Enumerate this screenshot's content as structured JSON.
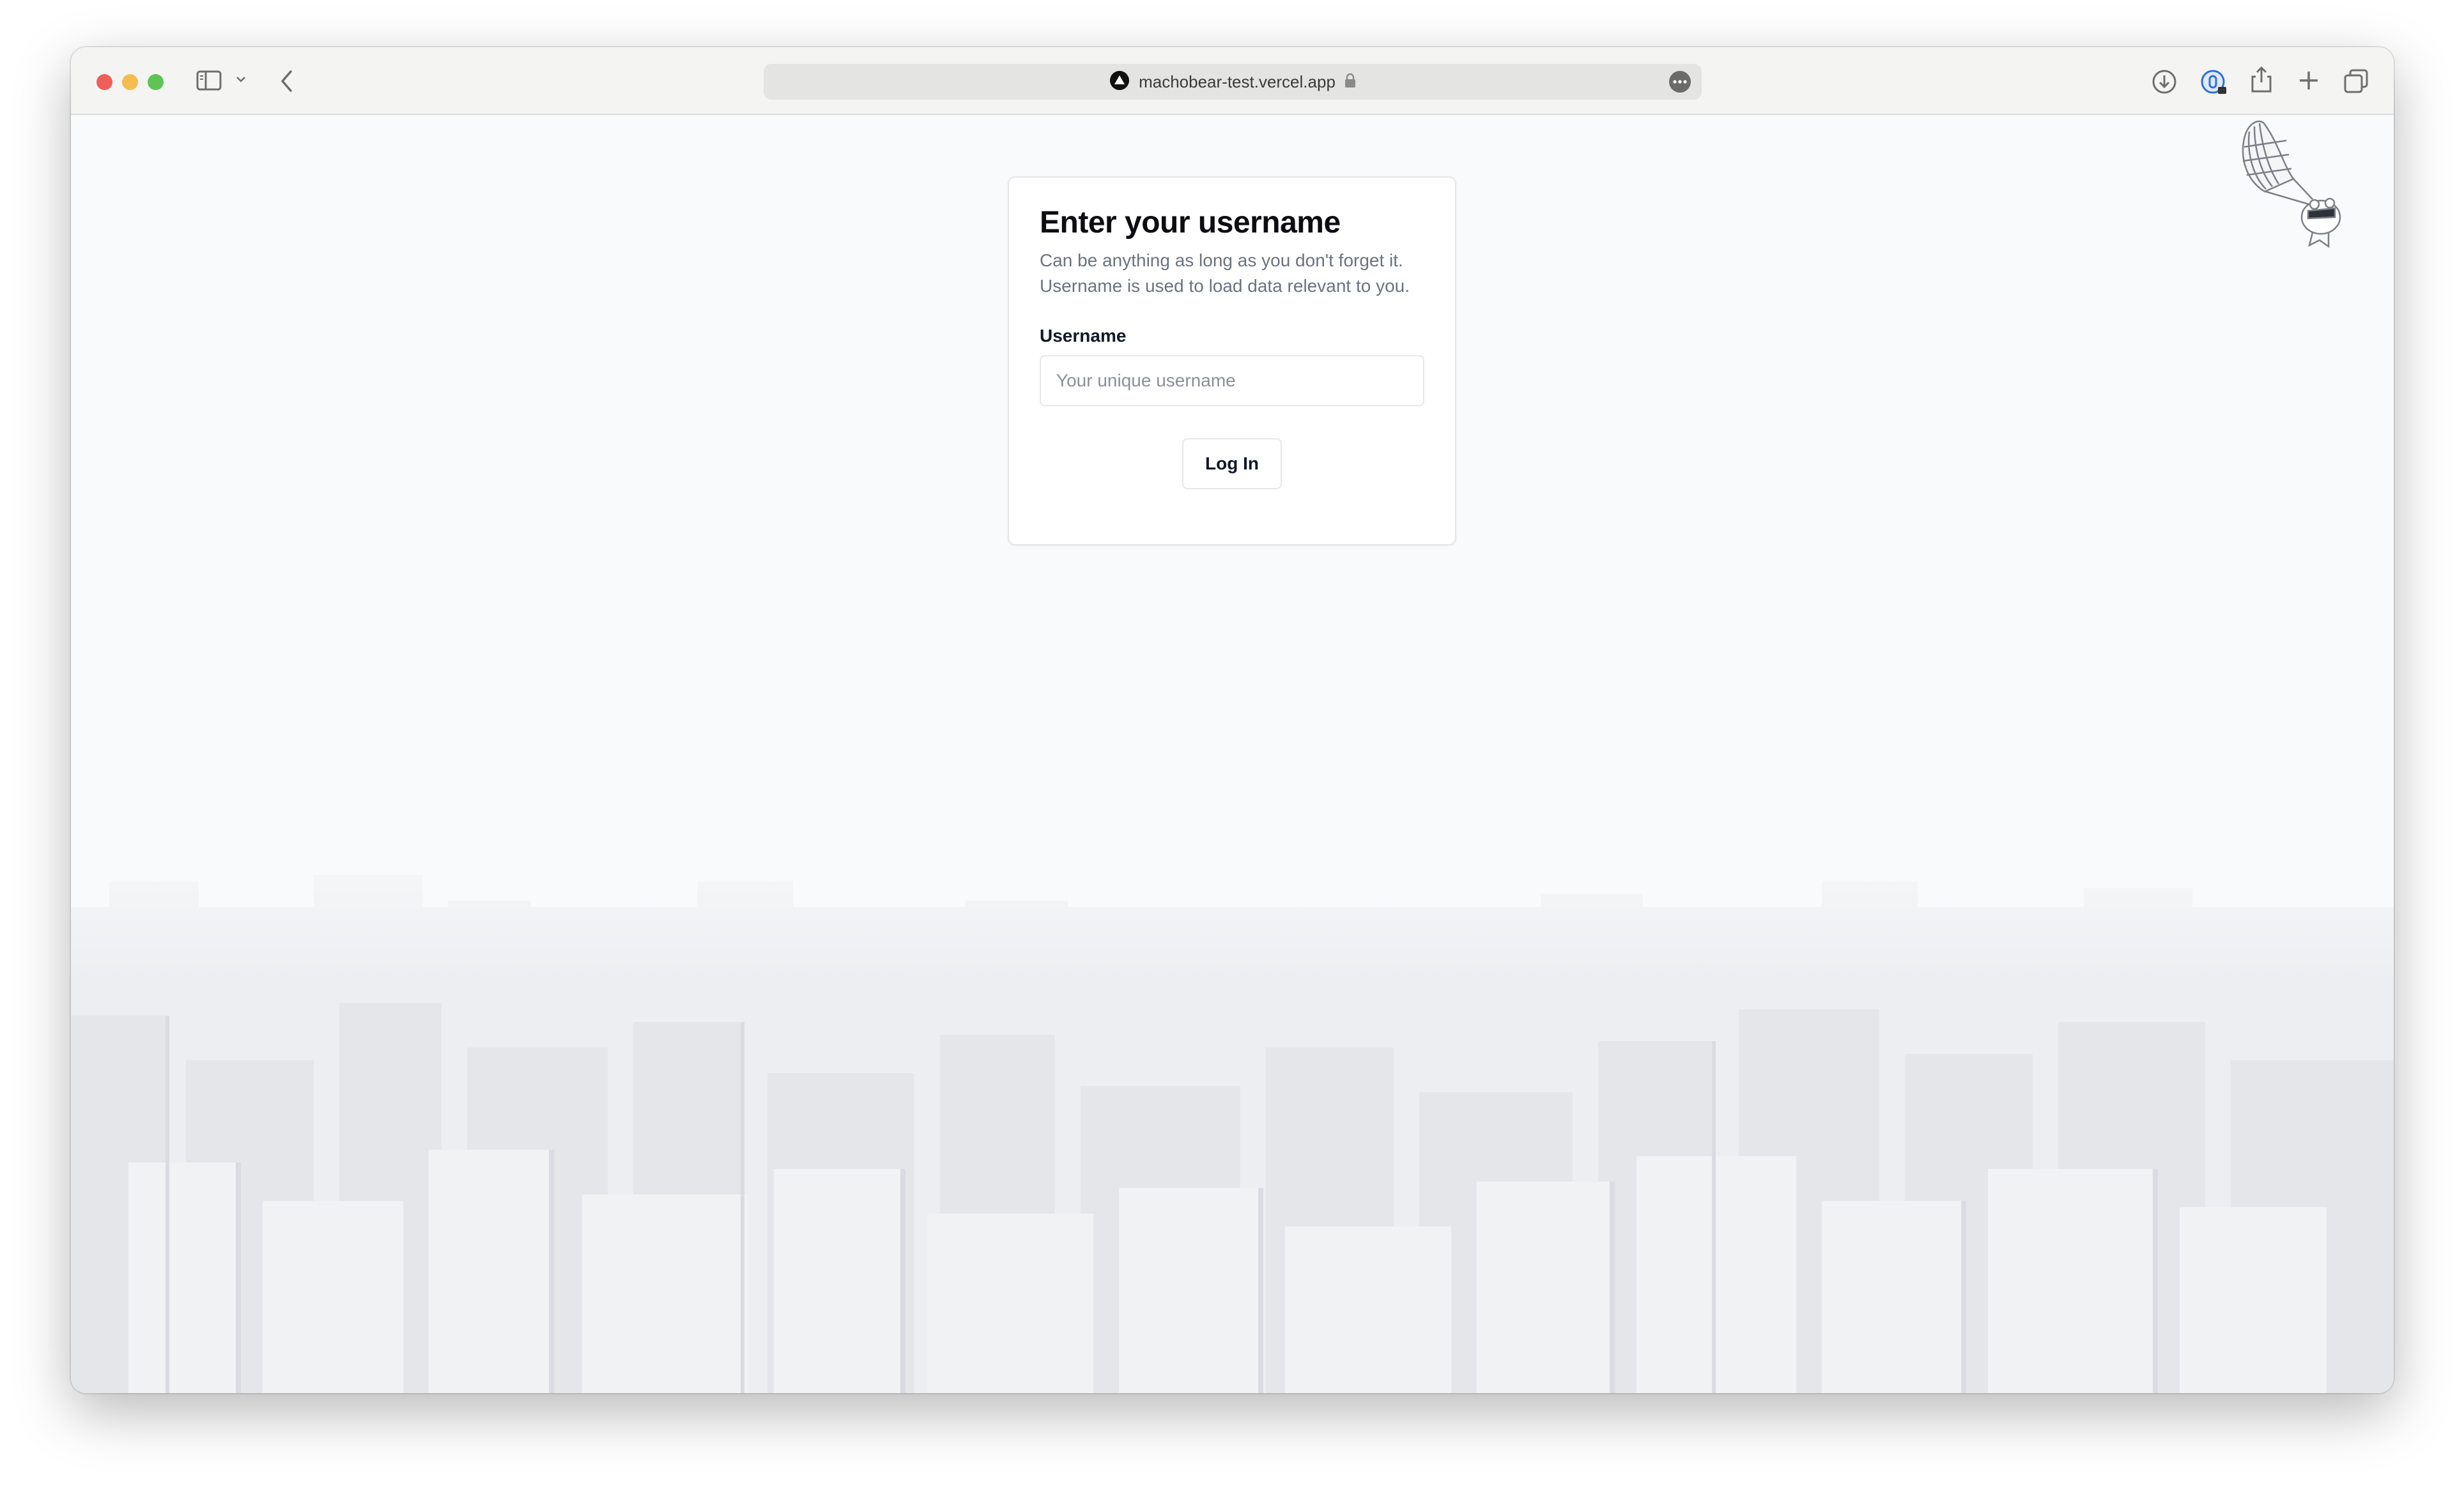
{
  "browser": {
    "url": "machobear-test.vercel.app",
    "icons": {
      "sidebar": "sidebar-toggle-icon",
      "chevron": "chevron-down-icon",
      "back": "back-arrow-icon",
      "site": "vercel-triangle-icon",
      "lock": "lock-icon",
      "more": "ellipsis-icon",
      "download": "download-icon",
      "extension": "password-extension-icon",
      "share": "share-icon",
      "new_tab": "plus-icon",
      "tabs": "tab-overview-icon"
    }
  },
  "login": {
    "title": "Enter your username",
    "description": "Can be anything as long as you don't forget it. Username is used to load data relevant to you.",
    "username_label": "Username",
    "username_placeholder": "Your unique username",
    "username_value": "",
    "submit_label": "Log In"
  },
  "colors": {
    "page_background": "#f9fafb",
    "card_background": "#ffffff",
    "title_text": "#0c0c12",
    "muted_text": "#6b7280",
    "border": "#e5e7eb"
  }
}
